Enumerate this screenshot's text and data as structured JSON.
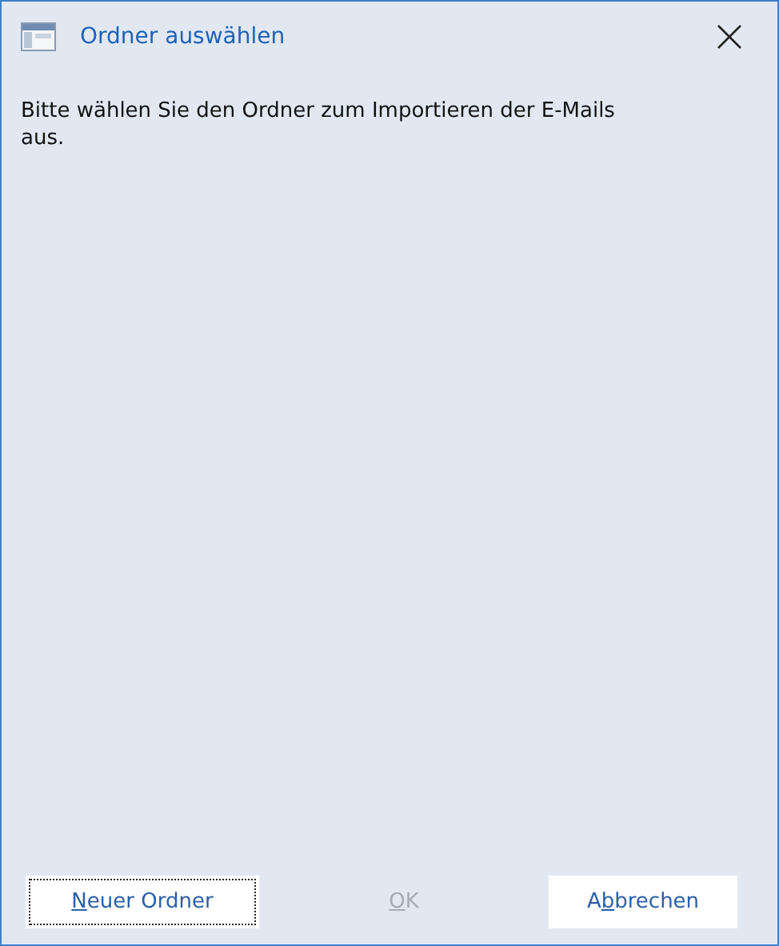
{
  "window": {
    "title": "Ordner auswählen"
  },
  "message": "Bitte wählen Sie den Ordner zum Importieren der E-Mails aus.",
  "buttons": [
    {
      "label_parts": [
        {
          "text": "N",
          "underlined": true
        },
        {
          "text": "euer Ordner",
          "underlined": false
        }
      ],
      "focused": true,
      "disabled": false,
      "kind": "default"
    },
    {
      "label_parts": [
        {
          "text": "O",
          "underlined": true
        },
        {
          "text": "K",
          "underlined": false
        }
      ],
      "focused": false,
      "disabled": true,
      "kind": "flat"
    },
    {
      "label_parts": [
        {
          "text": "A",
          "underlined": false
        },
        {
          "text": "b",
          "underlined": true
        },
        {
          "text": "brechen",
          "underlined": false
        }
      ],
      "focused": false,
      "disabled": false,
      "kind": "default"
    }
  ]
}
